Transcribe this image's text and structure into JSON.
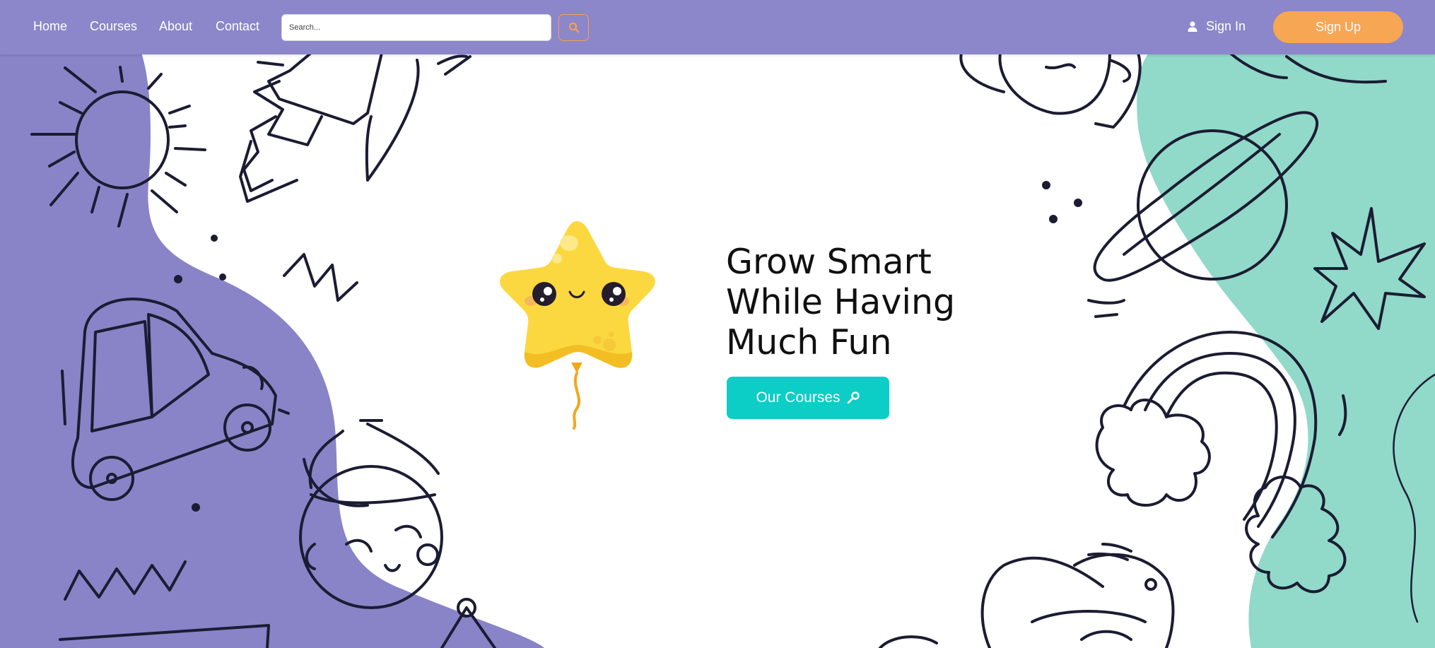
{
  "nav": {
    "links": [
      {
        "label": "Home"
      },
      {
        "label": "Courses"
      },
      {
        "label": "About"
      },
      {
        "label": "Contact"
      }
    ],
    "search": {
      "placeholder": "Search...",
      "icon": "search-icon"
    },
    "signin_label": "Sign In",
    "signup_label": "Sign Up"
  },
  "hero": {
    "title_lines": [
      "Grow Smart",
      "While Having",
      "Much Fun"
    ],
    "cta_label": "Our Courses",
    "cta_icon": "key-icon"
  },
  "colors": {
    "nav_bg": "#8b87ca",
    "purple_blob": "#8884c7",
    "teal_blob": "#91d9c9",
    "signup_bg": "#f7a654",
    "cta_bg": "#0ccec6",
    "star_yellow": "#fbd83f",
    "doodle_stroke": "#1b1c33"
  }
}
